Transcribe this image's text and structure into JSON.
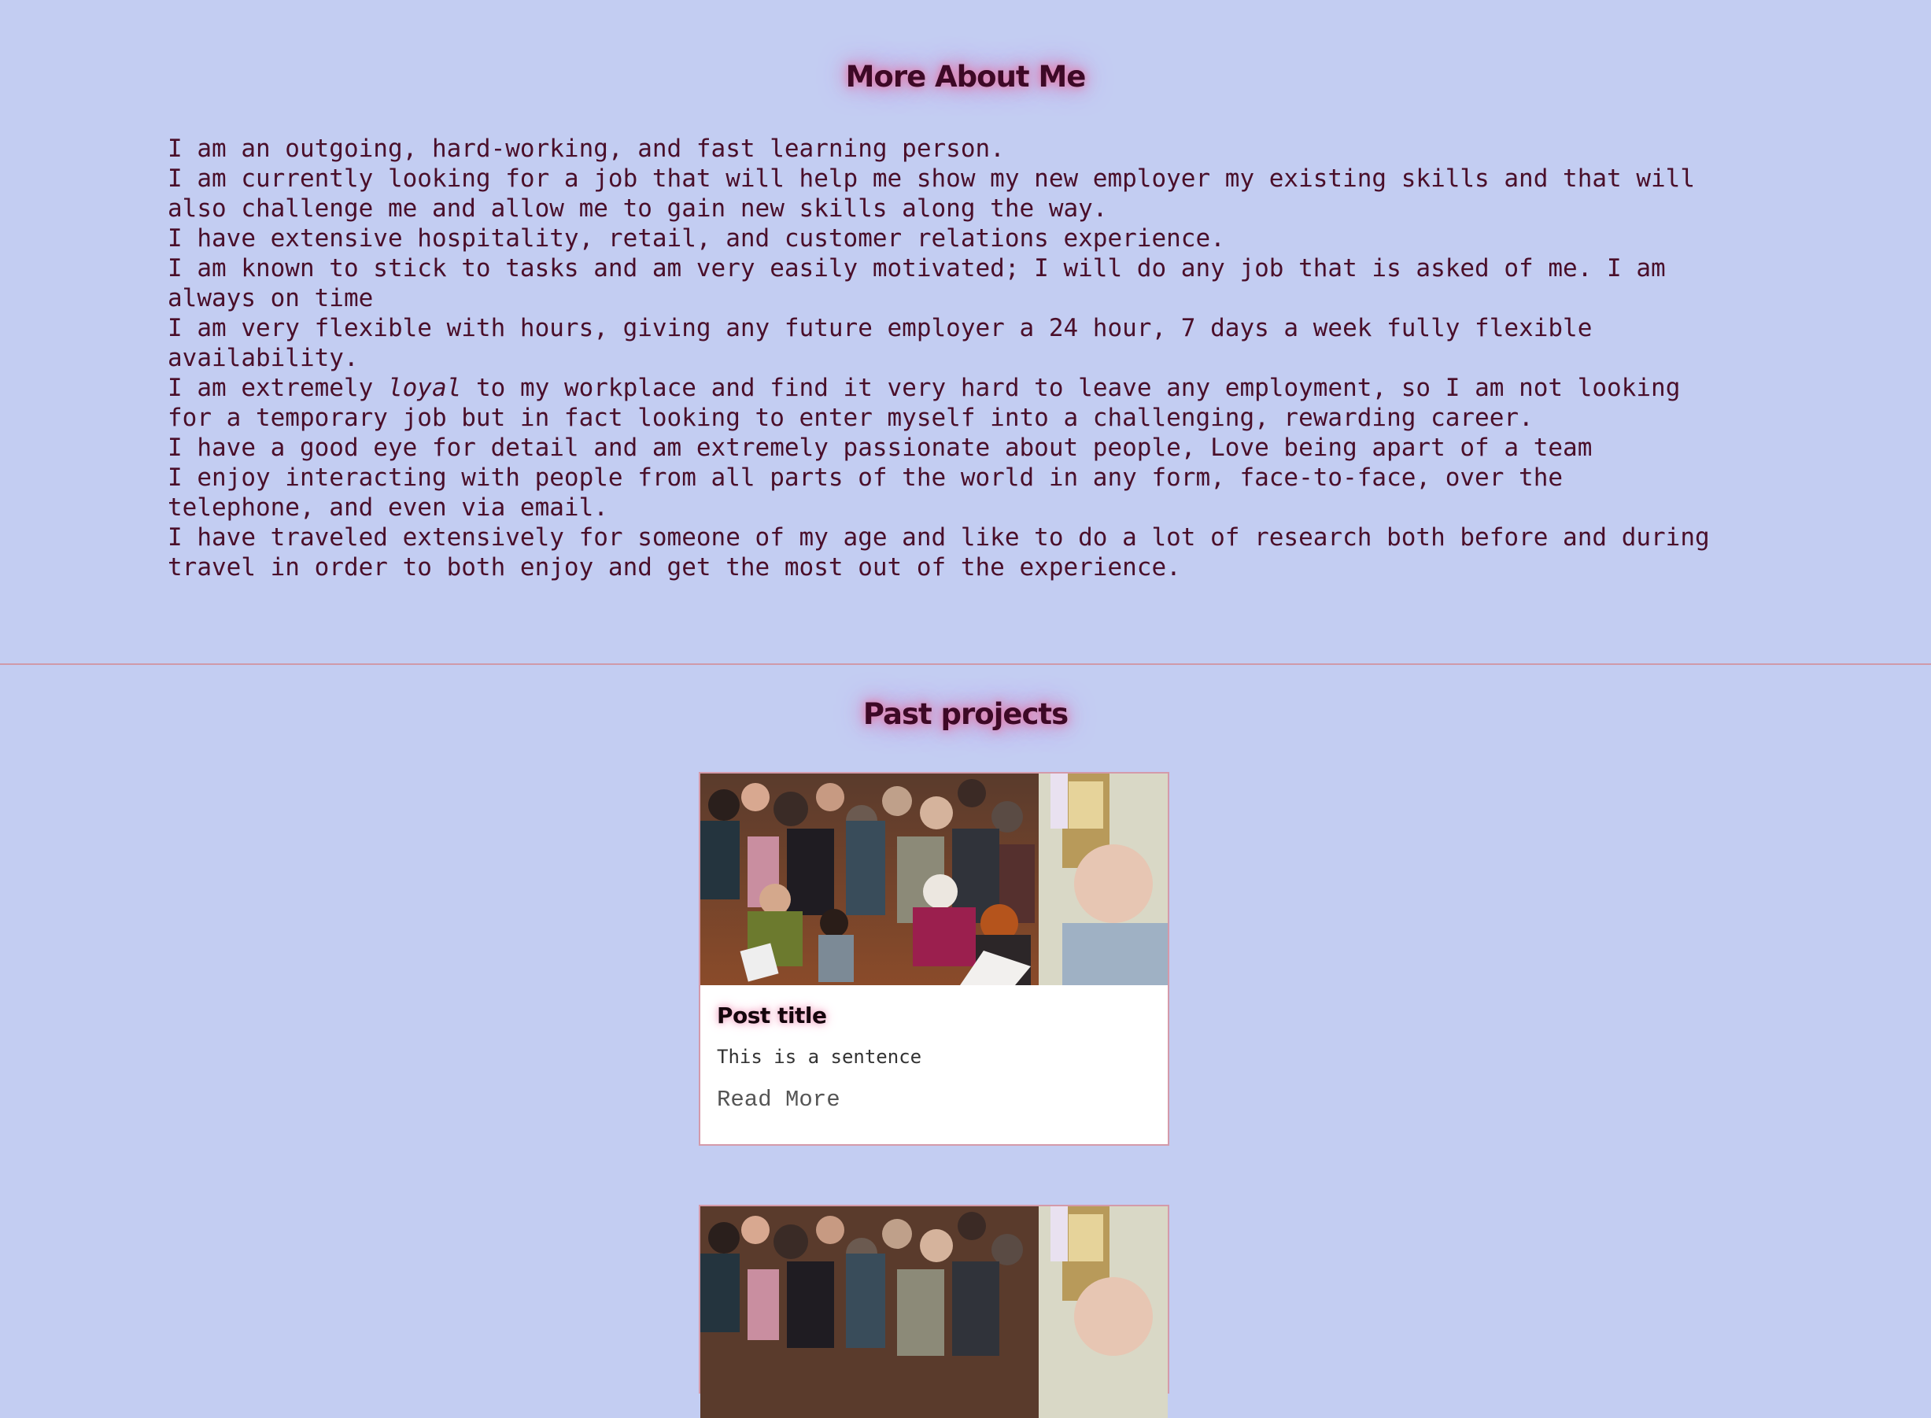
{
  "about": {
    "heading": "More About Me",
    "lines": [
      "I am an outgoing, hard-working, and fast learning person.",
      "I am currently looking for a job that will help me show my new employer my existing skills and that will also challenge me and allow me to gain new skills along the way.",
      "I have extensive hospitality, retail, and customer relations experience.",
      "I am known to stick to tasks and am very easily motivated; I will do any job that is asked of me. I am always on time",
      "I am very flexible with hours, giving any future employer a 24 hour, 7 days a week fully flexible availability.",
      "I have a good eye for detail and am extremely passionate about people, Love being apart of a team",
      "I enjoy interacting with people from all parts of the world in any form, face-to-face, over the telephone, and even via email.",
      "I have traveled extensively for someone of my age and like to do a lot of research both before and during travel in order to both enjoy and get the most out of the experience."
    ],
    "loyal_line": {
      "before": "I am extremely ",
      "emphasis": "loyal",
      "after": " to my workplace and find it very hard to leave any employment, so I am not looking for a temporary job but in fact looking to enter myself into a challenging, rewarding career."
    }
  },
  "projects": {
    "heading": "Past projects",
    "cards": [
      {
        "title": "Post title",
        "text": "This is a sentence",
        "link_label": "Read More"
      },
      {
        "title": "",
        "text": "",
        "link_label": ""
      }
    ]
  },
  "colors": {
    "background": "#c3cdf2",
    "text": "#4a0f2a",
    "divider": "#cf9aa9",
    "card_border": "#d49aaa",
    "glow": "#e07aa8"
  }
}
